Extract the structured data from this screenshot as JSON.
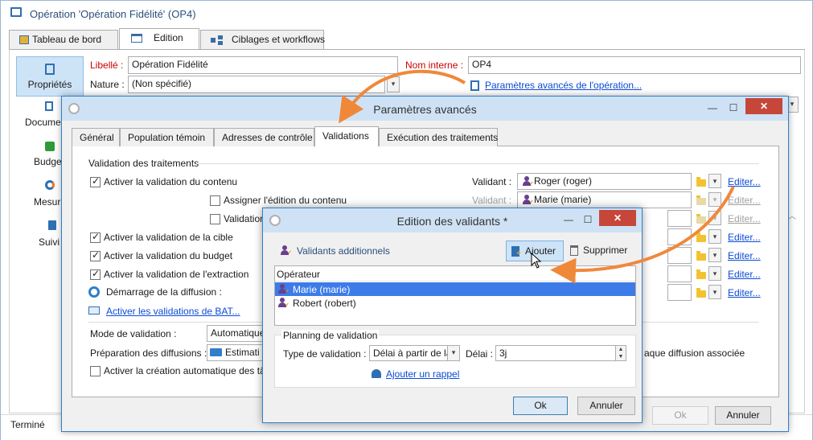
{
  "main_window": {
    "title": "Opération 'Opération Fidélité' (OP4)",
    "tabs": [
      "Tableau de bord",
      "Edition",
      "Ciblages et workflows"
    ],
    "active_tab": "Edition",
    "sidebar": [
      "Propriétés",
      "Docume",
      "Budge",
      "Mesur",
      "Suivi"
    ],
    "libelle_label": "Libellé :",
    "libelle_value": "Opération Fidélité",
    "nom_interne_label": "Nom interne :",
    "nom_interne_value": "OP4",
    "nature_label": "Nature :",
    "nature_value": "(Non spécifié)",
    "advanced_link": "Paramètres avancés de l'opération...",
    "status": "Terminé"
  },
  "adv_dialog": {
    "title": "Paramètres avancés",
    "tabs": [
      "Général",
      "Population témoin",
      "Adresses de contrôle",
      "Validations",
      "Exécution des traitements"
    ],
    "active_tab": "Validations",
    "group_title": "Validation des traitements",
    "rows": [
      {
        "label": "Activer la validation du contenu",
        "checked": true
      },
      {
        "label": "Assigner l'édition du contenu",
        "checked": false
      },
      {
        "label": "Validation",
        "checked": false
      },
      {
        "label": "Activer la validation de la cible",
        "checked": true
      },
      {
        "label": "Activer la validation du budget",
        "checked": true
      },
      {
        "label": "Activer la validation de l'extraction",
        "checked": true
      }
    ],
    "demarrage_label": "Démarrage de la diffusion :",
    "bat_link": "Activer les validations de BAT...",
    "validant_label": "Validant :",
    "validant1": "Roger (roger)",
    "validant2": "Marie (marie)",
    "editer": "Editer...",
    "mode_label": "Mode de validation :",
    "mode_value": "Automatique",
    "prep_label": "Préparation des diffusions :",
    "prep_value": "Estimati",
    "prep_suffix": "aque diffusion associée",
    "auto_label": "Activer la création automatique des tâ",
    "ok": "Ok",
    "cancel": "Annuler"
  },
  "val_dialog": {
    "title": "Edition des validants *",
    "section": "Validants additionnels",
    "add": "Ajouter",
    "remove": "Supprimer",
    "column": "Opérateur",
    "operators": [
      "Marie (marie)",
      "Robert (robert)"
    ],
    "selected": 0,
    "planning_title": "Planning de validation",
    "type_label": "Type de validation :",
    "type_value": "Délai à partir de la",
    "delai_label": "Délai :",
    "delai_value": "3j",
    "reminder_link": "Ajouter un rappel",
    "ok": "Ok",
    "cancel": "Annuler"
  },
  "colors": {
    "dialog_frame": "#2f7fc9",
    "dialog_title_bg": "#cfe2f5",
    "arrow": "#f0883a",
    "selection": "#3d7ce8",
    "link": "#0b4bd6",
    "required_label": "#cc0000"
  }
}
